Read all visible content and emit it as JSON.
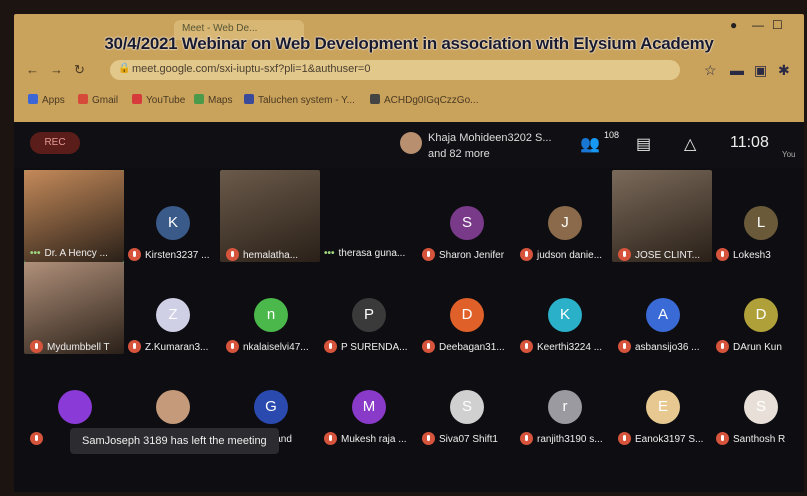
{
  "banner": "30/4/2021 Webinar on Web Development in association with Elysium Academy",
  "tab": {
    "title": "Meet - Web De..."
  },
  "url": "meet.google.com/sxi-iuptu-sxf?pli=1&authuser=0",
  "bookmarks": [
    {
      "label": "Apps",
      "icon": "apps-grid-icon",
      "color": "#3a66d6"
    },
    {
      "label": "Gmail",
      "icon": "gmail-icon",
      "color": "#d64a3a"
    },
    {
      "label": "YouTube",
      "icon": "youtube-icon",
      "color": "#d63a3a"
    },
    {
      "label": "Maps",
      "icon": "maps-icon",
      "color": "#4a9a4a"
    },
    {
      "label": "Taluchen system - Y...",
      "icon": "bookmark-icon",
      "color": "#3a4a9a"
    },
    {
      "label": "ACHDg0IGqCzzGo...",
      "icon": "bookmark-icon",
      "color": "#444"
    }
  ],
  "meet": {
    "rec_label": "REC",
    "presenter_line1": "Khaja Mohideen3202 S...",
    "presenter_line2": "and 82 more",
    "participants_count": "108",
    "time": "11:08",
    "you_label": "You"
  },
  "tiles": [
    {
      "name": "Dr. A Hency ...",
      "mic": "dots",
      "kind": "photo",
      "color": "#c48a5a",
      "active": true
    },
    {
      "name": "Kirsten3237 ...",
      "mic": "muted",
      "kind": "avatar",
      "initial": "K",
      "color": "#3a5a8a"
    },
    {
      "name": "hemalatha...",
      "mic": "muted",
      "kind": "photo",
      "color": "#6a5a4a"
    },
    {
      "name": "therasa guna...",
      "mic": "dots",
      "kind": "blank",
      "color": "#0e0e12"
    },
    {
      "name": "Sharon Jenifer",
      "mic": "muted",
      "kind": "avatar",
      "initial": "S",
      "color": "#7a3a8a"
    },
    {
      "name": "judson danie...",
      "mic": "muted",
      "kind": "avatar",
      "initial": "J",
      "color": "#8a6a4a"
    },
    {
      "name": "JOSE CLINT...",
      "mic": "muted",
      "kind": "photo",
      "color": "#7a6a5a"
    },
    {
      "name": "Lokesh3",
      "mic": "muted",
      "kind": "avatar",
      "initial": "L",
      "color": "#6a5a3a"
    },
    {
      "name": "Mydumbbell T",
      "mic": "muted",
      "kind": "photo",
      "color": "#b0907a"
    },
    {
      "name": "Z.Kumaran3...",
      "mic": "muted",
      "kind": "avatar",
      "initial": "Z",
      "color": "#cfcfe6"
    },
    {
      "name": "nkalaiselvi47...",
      "mic": "muted",
      "kind": "avatar",
      "initial": "n",
      "color": "#4ab84a"
    },
    {
      "name": "P SURENDA...",
      "mic": "muted",
      "kind": "avatar",
      "initial": "P",
      "color": "#3a3a3a"
    },
    {
      "name": "Deebagan31...",
      "mic": "muted",
      "kind": "avatar",
      "initial": "D",
      "color": "#e0602a"
    },
    {
      "name": "Keerthi3224 ...",
      "mic": "muted",
      "kind": "avatar",
      "initial": "K",
      "color": "#2ab0c8"
    },
    {
      "name": "asbansijo36 ...",
      "mic": "muted",
      "kind": "avatar",
      "initial": "A",
      "color": "#3a6ad6"
    },
    {
      "name": "DArun Kun",
      "mic": "muted",
      "kind": "avatar",
      "initial": "D",
      "color": "#b0a03a"
    },
    {
      "name": "",
      "mic": "muted",
      "kind": "avatar",
      "initial": "",
      "color": "#8a3ad6"
    },
    {
      "name": "",
      "mic": "muted",
      "kind": "avatar",
      "initial": "",
      "color": "#c49a7a"
    },
    {
      "name": "Gijo Anand",
      "mic": "muted",
      "kind": "avatar",
      "initial": "G",
      "color": "#2a4ab0"
    },
    {
      "name": "Mukesh raja ...",
      "mic": "muted",
      "kind": "avatar",
      "initial": "M",
      "color": "#8a3ac8"
    },
    {
      "name": "Siva07 Shift1",
      "mic": "muted",
      "kind": "avatar",
      "initial": "S",
      "color": "#d0d0d0"
    },
    {
      "name": "ranjith3190 s...",
      "mic": "muted",
      "kind": "avatar",
      "initial": "r",
      "color": "#9a9aa0"
    },
    {
      "name": "Eanok3197 S...",
      "mic": "muted",
      "kind": "avatar",
      "initial": "E",
      "color": "#e6c890"
    },
    {
      "name": "Santhosh R",
      "mic": "muted",
      "kind": "avatar",
      "initial": "S",
      "color": "#e8e0d8"
    }
  ],
  "toast": "SamJoseph 3189 has left the meeting"
}
